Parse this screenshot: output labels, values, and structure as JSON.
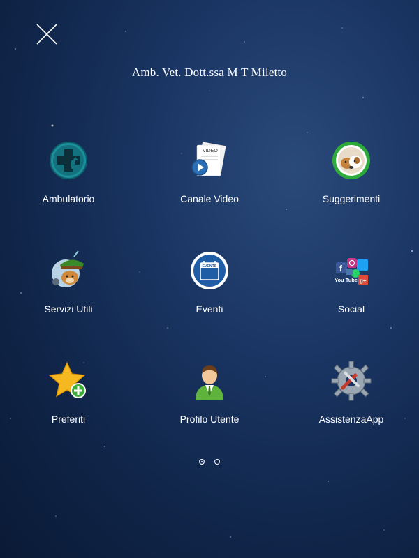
{
  "header": {
    "title": "Amb. Vet. Dott.ssa M T Miletto"
  },
  "grid": {
    "items": [
      {
        "label": "Ambulatorio",
        "icon": "medical-cross-icon"
      },
      {
        "label": "Canale Video",
        "icon": "video-play-icon"
      },
      {
        "label": "Suggerimenti",
        "icon": "dog-photo-icon"
      },
      {
        "label": "Servizi Utili",
        "icon": "dog-hat-icon"
      },
      {
        "label": "Eventi",
        "icon": "events-calendar-icon"
      },
      {
        "label": "Social",
        "icon": "social-networks-icon"
      },
      {
        "label": "Preferiti",
        "icon": "star-add-icon"
      },
      {
        "label": "Profilo Utente",
        "icon": "user-profile-icon"
      },
      {
        "label": "AssistenzaApp",
        "icon": "gear-tools-icon"
      }
    ]
  },
  "icon_text": {
    "video": "VIDEO",
    "events": "EVENTS",
    "youtube": "You Tube"
  },
  "pager": {
    "total": 2,
    "current": 1
  },
  "colors": {
    "background": "#1a3563",
    "text": "#ffffff"
  }
}
